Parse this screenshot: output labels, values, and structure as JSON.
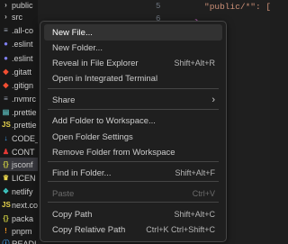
{
  "explorer": {
    "items": [
      {
        "label": "public",
        "icon": "folder-chevron-icon",
        "glyph": "›",
        "color": "#c5c5c5"
      },
      {
        "label": "src",
        "icon": "folder-chevron-icon",
        "glyph": "›",
        "color": "#c5c5c5"
      },
      {
        "label": ".all-co",
        "icon": "file-icon",
        "glyph": "≡",
        "color": "#9da5b4"
      },
      {
        "label": ".eslint",
        "icon": "eslint-icon",
        "glyph": "●",
        "color": "#8080f2"
      },
      {
        "label": ".eslint",
        "icon": "eslint-icon",
        "glyph": "●",
        "color": "#8080f2"
      },
      {
        "label": ".gitatt",
        "icon": "git-icon",
        "glyph": "◆",
        "color": "#f14e32"
      },
      {
        "label": ".gitign",
        "icon": "git-icon",
        "glyph": "◆",
        "color": "#f14e32"
      },
      {
        "label": ".nvmrc",
        "icon": "file-icon",
        "glyph": "≡",
        "color": "#9da5b4"
      },
      {
        "label": ".prettie",
        "icon": "prettier-icon",
        "glyph": "▤",
        "color": "#56b3b4"
      },
      {
        "label": ".prettie",
        "icon": "js-icon",
        "glyph": "JS",
        "color": "#e8d44d"
      },
      {
        "label": "CODE_",
        "icon": "markdown-icon",
        "glyph": "↓",
        "color": "#42a5f5"
      },
      {
        "label": "CONT",
        "icon": "contributing-icon",
        "glyph": "♟",
        "color": "#e53935"
      },
      {
        "label": "jsconf",
        "icon": "json-icon",
        "glyph": "{}",
        "color": "#cbcb41"
      },
      {
        "label": "LICEN",
        "icon": "license-icon",
        "glyph": "♛",
        "color": "#e8d44d"
      },
      {
        "label": "netlify",
        "icon": "netlify-icon",
        "glyph": "❖",
        "color": "#3ec7c2"
      },
      {
        "label": "next.co",
        "icon": "js-icon",
        "glyph": "JS",
        "color": "#e8d44d"
      },
      {
        "label": "packa",
        "icon": "package-icon",
        "glyph": "{}",
        "color": "#cbcb41"
      },
      {
        "label": "pnpm",
        "icon": "pnpm-icon",
        "glyph": "!",
        "color": "#f69220"
      },
      {
        "label": "READI",
        "icon": "info-icon",
        "glyph": "ⓘ",
        "color": "#42a5f5"
      }
    ]
  },
  "editor": {
    "line_numbers": [
      "5",
      "6"
    ],
    "code_line": "\"public/*\": [\"."
  },
  "context_menu": {
    "groups": [
      [
        {
          "label": "New File...",
          "shortcut": "",
          "state": "hover"
        },
        {
          "label": "New Folder...",
          "shortcut": "",
          "state": "normal"
        },
        {
          "label": "Reveal in File Explorer",
          "shortcut": "Shift+Alt+R",
          "state": "normal"
        },
        {
          "label": "Open in Integrated Terminal",
          "shortcut": "",
          "state": "normal"
        }
      ],
      [
        {
          "label": "Share",
          "shortcut": "",
          "state": "submenu"
        }
      ],
      [
        {
          "label": "Add Folder to Workspace...",
          "shortcut": "",
          "state": "normal"
        },
        {
          "label": "Open Folder Settings",
          "shortcut": "",
          "state": "normal"
        },
        {
          "label": "Remove Folder from Workspace",
          "shortcut": "",
          "state": "normal"
        }
      ],
      [
        {
          "label": "Find in Folder...",
          "shortcut": "Shift+Alt+F",
          "state": "normal"
        }
      ],
      [
        {
          "label": "Paste",
          "shortcut": "Ctrl+V",
          "state": "disabled"
        }
      ],
      [
        {
          "label": "Copy Path",
          "shortcut": "Shift+Alt+C",
          "state": "normal"
        },
        {
          "label": "Copy Relative Path",
          "shortcut": "Ctrl+K Ctrl+Shift+C",
          "state": "normal"
        }
      ]
    ]
  }
}
